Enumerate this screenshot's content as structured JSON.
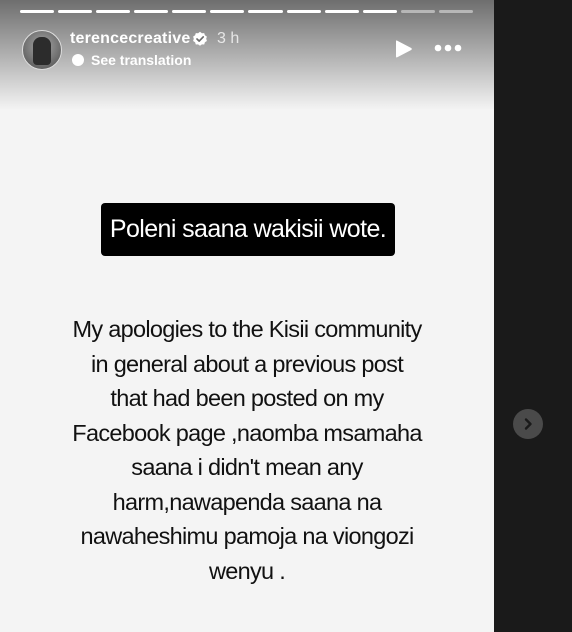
{
  "story": {
    "progress": {
      "segments": 12,
      "completed": 10
    },
    "user": {
      "username": "terencecreative",
      "verified": true,
      "time": "3 h"
    },
    "see_translation": "See translation",
    "headline": "Poleni saana wakisii wote.",
    "message": "My apologies to the Kisii community\nin general about a previous post\nthat  had been posted on my\nFacebook page ,naomba msamaha\nsaana i didn't mean any\nharm,nawapenda saana na\nnawaheshimu pamoja na viongozi\nwenyu ."
  },
  "controls": {
    "play_icon": "play-icon",
    "more_icon": "more-options-icon",
    "next_icon": "chevron-right-icon"
  },
  "colors": {
    "story_background": "#f4f4f4",
    "page_background": "#1a1a1a",
    "headline_background": "#000000"
  }
}
